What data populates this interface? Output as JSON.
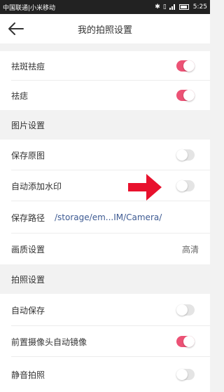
{
  "status_bar": {
    "carrier": "中国联通|小米移动",
    "time": "5:25"
  },
  "header": {
    "title": "我的拍照设置",
    "back_icon": "back-arrow-icon"
  },
  "rows": {
    "freckle": {
      "label": "祛斑祛痘",
      "toggle": true
    },
    "eye_bag": {
      "label": "祛痣",
      "toggle": true
    },
    "save_original": {
      "label": "保存原图",
      "toggle": false
    },
    "watermark": {
      "label": "自动添加水印",
      "toggle": false
    },
    "save_path": {
      "label": "保存路径",
      "value": "/storage/em...IM/Camera/"
    },
    "quality": {
      "label": "画质设置",
      "value": "高清"
    },
    "auto_save": {
      "label": "自动保存",
      "toggle": false
    },
    "front_mirror": {
      "label": "前置摄像头自动镜像",
      "toggle": true
    },
    "mute": {
      "label": "静音拍照",
      "toggle": false
    }
  },
  "sections": {
    "image": "图片设置",
    "photo": "拍照设置"
  },
  "colors": {
    "toggle_on": "#ec5275",
    "toggle_off": "#e4e4e4",
    "annotation_arrow": "#e8112d",
    "link_blue": "#3d5a92"
  }
}
